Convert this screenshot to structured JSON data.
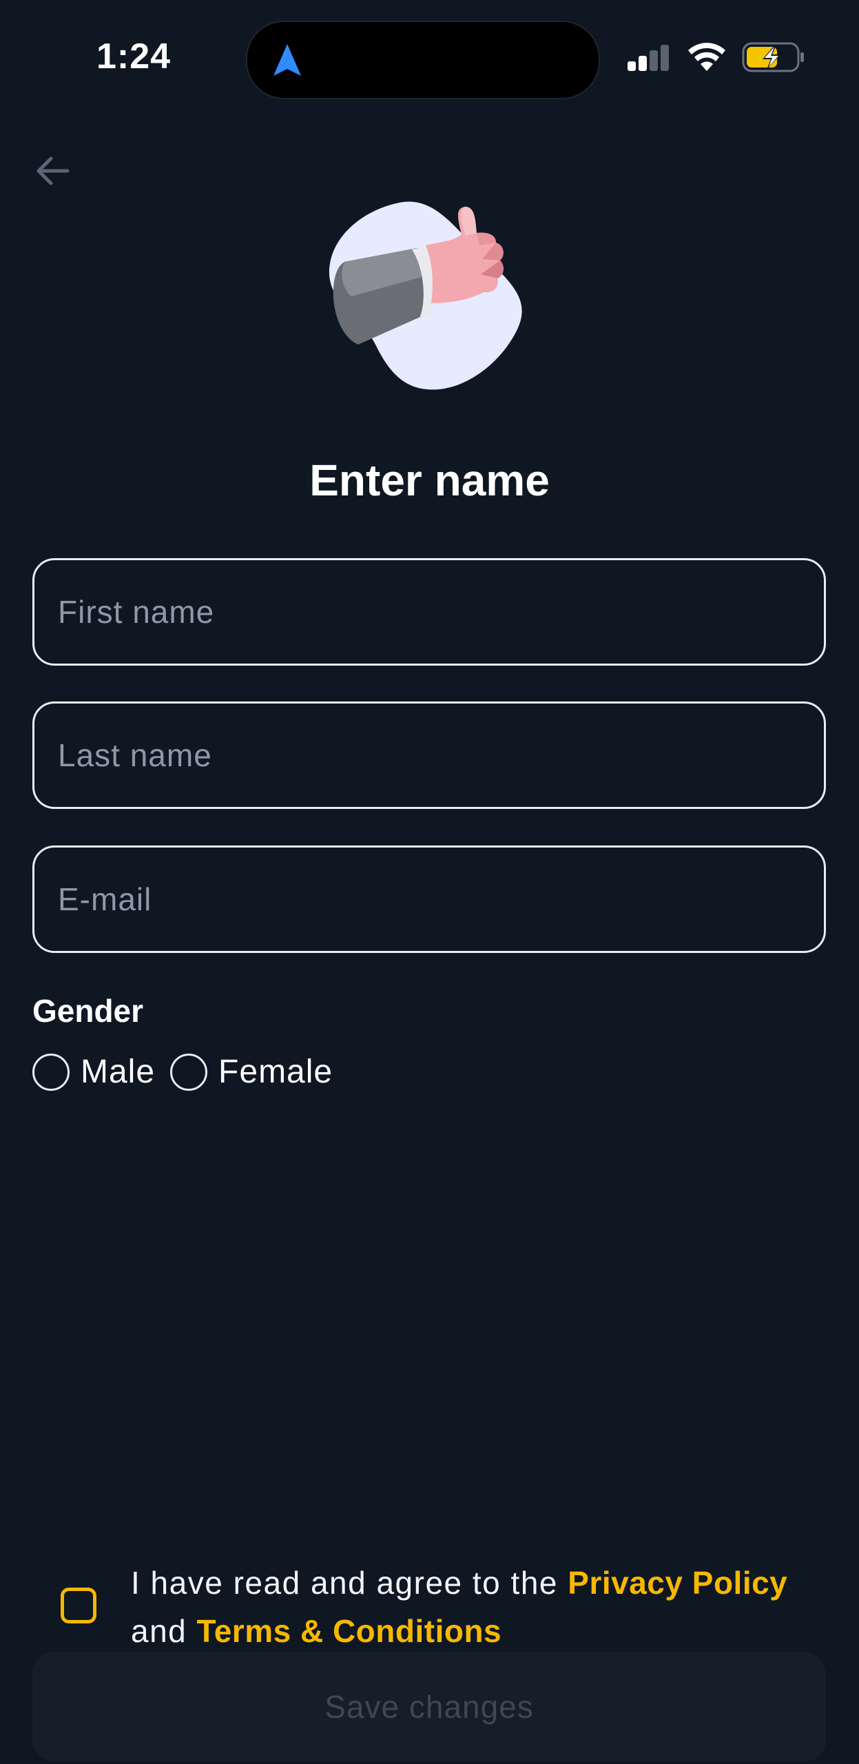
{
  "status_bar": {
    "time": "1:24"
  },
  "page": {
    "title": "Enter name",
    "fields": {
      "first_name_placeholder": "First name",
      "last_name_placeholder": "Last name",
      "email_placeholder": "E-mail"
    },
    "gender": {
      "label": "Gender",
      "options": [
        "Male",
        "Female"
      ]
    },
    "agreement": {
      "text_part1": "I have read and agree to the ",
      "privacy_link": "Privacy Policy",
      "text_part2": "and ",
      "terms_link": "Terms & Conditions"
    },
    "save_button": "Save changes"
  },
  "colors": {
    "background": "#0f1723",
    "accent": "#f6b800",
    "placeholder": "#8e98a8",
    "disabled_button_bg": "#161e2a",
    "disabled_button_text": "#3e4756"
  },
  "icons": [
    "navigation-arrow-icon",
    "signal-icon",
    "wifi-icon",
    "battery-charging-icon",
    "back-arrow-icon",
    "thumbs-up-illustration"
  ]
}
